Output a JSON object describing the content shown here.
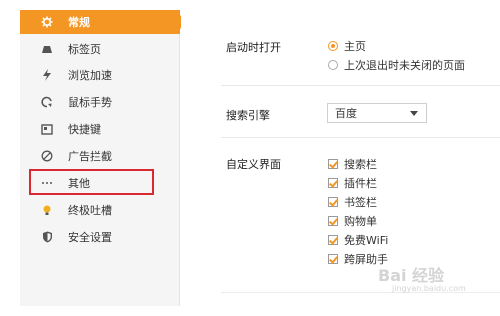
{
  "sidebar": {
    "items": [
      {
        "label": "常规",
        "icon": "gear-icon",
        "active": true
      },
      {
        "label": "标签页",
        "icon": "tab-icon",
        "active": false
      },
      {
        "label": "浏览加速",
        "icon": "lightning-icon",
        "active": false
      },
      {
        "label": "鼠标手势",
        "icon": "mouse-gesture-icon",
        "active": false
      },
      {
        "label": "快捷键",
        "icon": "keyboard-icon",
        "active": false
      },
      {
        "label": "广告拦截",
        "icon": "block-icon",
        "active": false
      },
      {
        "label": "其他",
        "icon": "more-dots-icon",
        "active": false
      },
      {
        "label": "终极吐槽",
        "icon": "feedback-icon",
        "active": false
      },
      {
        "label": "安全设置",
        "icon": "shield-icon",
        "active": false
      }
    ],
    "accent_color": "#f39623",
    "highlight_color": "#d9282f"
  },
  "startup": {
    "label": "启动时打开",
    "options": [
      {
        "label": "主页",
        "selected": true
      },
      {
        "label": "上次退出时未关闭的页面",
        "selected": false
      }
    ]
  },
  "search_engine": {
    "label": "搜索引擎",
    "selected": "百度"
  },
  "custom_ui": {
    "label": "自定义界面",
    "options": [
      {
        "label": "搜索栏",
        "checked": true
      },
      {
        "label": "插件栏",
        "checked": true
      },
      {
        "label": "书签栏",
        "checked": true
      },
      {
        "label": "购物单",
        "checked": true
      },
      {
        "label": "免费WiFi",
        "checked": true
      },
      {
        "label": "跨屏助手",
        "checked": true
      }
    ]
  },
  "watermark": {
    "text": "Bai 经验",
    "sub": "jingyan.baidu.com"
  }
}
